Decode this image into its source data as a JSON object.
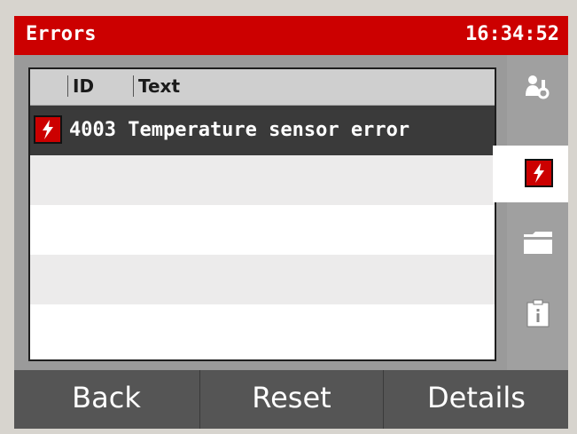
{
  "header": {
    "title": "Errors",
    "time": "16:34:52"
  },
  "table": {
    "columns": [
      "ID",
      "Text"
    ],
    "rows": [
      {
        "icon": "error-bolt-icon",
        "text": "4003 Temperature sensor error"
      }
    ]
  },
  "sidebar": {
    "tabs": [
      {
        "icon": "user-settings-icon",
        "active": false
      },
      {
        "icon": "error-bolt-icon",
        "active": true
      },
      {
        "icon": "folder-icon",
        "active": false
      },
      {
        "icon": "info-document-icon",
        "active": false
      }
    ]
  },
  "footer": {
    "buttons": [
      "Back",
      "Reset",
      "Details"
    ]
  },
  "colors": {
    "accent": "#cc0000",
    "selected_row": "#3a3a3a",
    "button_bar": "#555555"
  }
}
